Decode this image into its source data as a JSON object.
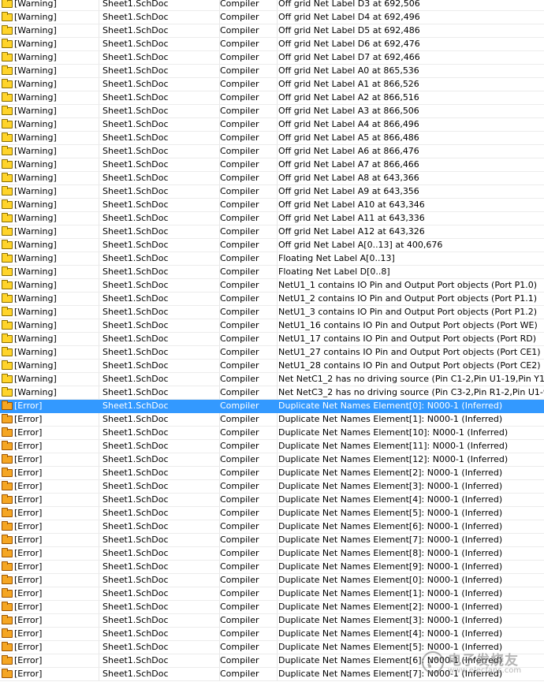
{
  "rows": [
    {
      "type": "warning",
      "label": "[Warning]",
      "document": "Sheet1.SchDoc",
      "source": "Compiler",
      "message": "Off grid Net Label D3 at 692,506"
    },
    {
      "type": "warning",
      "label": "[Warning]",
      "document": "Sheet1.SchDoc",
      "source": "Compiler",
      "message": "Off grid Net Label D4 at 692,496"
    },
    {
      "type": "warning",
      "label": "[Warning]",
      "document": "Sheet1.SchDoc",
      "source": "Compiler",
      "message": "Off grid Net Label D5 at 692,486"
    },
    {
      "type": "warning",
      "label": "[Warning]",
      "document": "Sheet1.SchDoc",
      "source": "Compiler",
      "message": "Off grid Net Label D6 at 692,476"
    },
    {
      "type": "warning",
      "label": "[Warning]",
      "document": "Sheet1.SchDoc",
      "source": "Compiler",
      "message": "Off grid Net Label D7 at 692,466"
    },
    {
      "type": "warning",
      "label": "[Warning]",
      "document": "Sheet1.SchDoc",
      "source": "Compiler",
      "message": "Off grid Net Label A0 at 865,536"
    },
    {
      "type": "warning",
      "label": "[Warning]",
      "document": "Sheet1.SchDoc",
      "source": "Compiler",
      "message": "Off grid Net Label A1 at 866,526"
    },
    {
      "type": "warning",
      "label": "[Warning]",
      "document": "Sheet1.SchDoc",
      "source": "Compiler",
      "message": "Off grid Net Label A2 at 866,516"
    },
    {
      "type": "warning",
      "label": "[Warning]",
      "document": "Sheet1.SchDoc",
      "source": "Compiler",
      "message": "Off grid Net Label A3 at 866,506"
    },
    {
      "type": "warning",
      "label": "[Warning]",
      "document": "Sheet1.SchDoc",
      "source": "Compiler",
      "message": "Off grid Net Label A4 at 866,496"
    },
    {
      "type": "warning",
      "label": "[Warning]",
      "document": "Sheet1.SchDoc",
      "source": "Compiler",
      "message": "Off grid Net Label A5 at 866,486"
    },
    {
      "type": "warning",
      "label": "[Warning]",
      "document": "Sheet1.SchDoc",
      "source": "Compiler",
      "message": "Off grid Net Label A6 at 866,476"
    },
    {
      "type": "warning",
      "label": "[Warning]",
      "document": "Sheet1.SchDoc",
      "source": "Compiler",
      "message": "Off grid Net Label A7 at 866,466"
    },
    {
      "type": "warning",
      "label": "[Warning]",
      "document": "Sheet1.SchDoc",
      "source": "Compiler",
      "message": "Off grid Net Label A8 at 643,366"
    },
    {
      "type": "warning",
      "label": "[Warning]",
      "document": "Sheet1.SchDoc",
      "source": "Compiler",
      "message": "Off grid Net Label A9 at 643,356"
    },
    {
      "type": "warning",
      "label": "[Warning]",
      "document": "Sheet1.SchDoc",
      "source": "Compiler",
      "message": "Off grid Net Label A10 at 643,346"
    },
    {
      "type": "warning",
      "label": "[Warning]",
      "document": "Sheet1.SchDoc",
      "source": "Compiler",
      "message": "Off grid Net Label A11 at 643,336"
    },
    {
      "type": "warning",
      "label": "[Warning]",
      "document": "Sheet1.SchDoc",
      "source": "Compiler",
      "message": "Off grid Net Label A12 at 643,326"
    },
    {
      "type": "warning",
      "label": "[Warning]",
      "document": "Sheet1.SchDoc",
      "source": "Compiler",
      "message": "Off grid Net Label A[0..13] at 400,676"
    },
    {
      "type": "warning",
      "label": "[Warning]",
      "document": "Sheet1.SchDoc",
      "source": "Compiler",
      "message": "Floating Net Label A[0..13]"
    },
    {
      "type": "warning",
      "label": "[Warning]",
      "document": "Sheet1.SchDoc",
      "source": "Compiler",
      "message": "Floating Net Label D[0..8]"
    },
    {
      "type": "warning",
      "label": "[Warning]",
      "document": "Sheet1.SchDoc",
      "source": "Compiler",
      "message": "NetU1_1 contains IO Pin and Output Port objects (Port P1.0)"
    },
    {
      "type": "warning",
      "label": "[Warning]",
      "document": "Sheet1.SchDoc",
      "source": "Compiler",
      "message": "NetU1_2 contains IO Pin and Output Port objects (Port P1.1)"
    },
    {
      "type": "warning",
      "label": "[Warning]",
      "document": "Sheet1.SchDoc",
      "source": "Compiler",
      "message": "NetU1_3 contains IO Pin and Output Port objects (Port P1.2)"
    },
    {
      "type": "warning",
      "label": "[Warning]",
      "document": "Sheet1.SchDoc",
      "source": "Compiler",
      "message": "NetU1_16 contains IO Pin and Output Port objects (Port WE)"
    },
    {
      "type": "warning",
      "label": "[Warning]",
      "document": "Sheet1.SchDoc",
      "source": "Compiler",
      "message": "NetU1_17 contains IO Pin and Output Port objects (Port RD)"
    },
    {
      "type": "warning",
      "label": "[Warning]",
      "document": "Sheet1.SchDoc",
      "source": "Compiler",
      "message": "NetU1_27 contains IO Pin and Output Port objects (Port CE1)"
    },
    {
      "type": "warning",
      "label": "[Warning]",
      "document": "Sheet1.SchDoc",
      "source": "Compiler",
      "message": "NetU1_28 contains IO Pin and Output Port objects (Port CE2)"
    },
    {
      "type": "warning",
      "label": "[Warning]",
      "document": "Sheet1.SchDoc",
      "source": "Compiler",
      "message": "Net NetC1_2 has no driving source (Pin C1-2,Pin U1-19,Pin Y1-2)"
    },
    {
      "type": "warning",
      "label": "[Warning]",
      "document": "Sheet1.SchDoc",
      "source": "Compiler",
      "message": "Net NetC3_2 has no driving source (Pin C3-2,Pin R1-2,Pin U1-9)"
    },
    {
      "type": "error",
      "label": "[Error]",
      "document": "Sheet1.SchDoc",
      "source": "Compiler",
      "message": "Duplicate Net Names Element[0]: N000-1 (Inferred)",
      "selected": true
    },
    {
      "type": "error",
      "label": "[Error]",
      "document": "Sheet1.SchDoc",
      "source": "Compiler",
      "message": "Duplicate Net Names Element[1]: N000-1 (Inferred)"
    },
    {
      "type": "error",
      "label": "[Error]",
      "document": "Sheet1.SchDoc",
      "source": "Compiler",
      "message": "Duplicate Net Names Element[10]: N000-1 (Inferred)"
    },
    {
      "type": "error",
      "label": "[Error]",
      "document": "Sheet1.SchDoc",
      "source": "Compiler",
      "message": "Duplicate Net Names Element[11]: N000-1 (Inferred)"
    },
    {
      "type": "error",
      "label": "[Error]",
      "document": "Sheet1.SchDoc",
      "source": "Compiler",
      "message": "Duplicate Net Names Element[12]: N000-1 (Inferred)"
    },
    {
      "type": "error",
      "label": "[Error]",
      "document": "Sheet1.SchDoc",
      "source": "Compiler",
      "message": "Duplicate Net Names Element[2]: N000-1 (Inferred)"
    },
    {
      "type": "error",
      "label": "[Error]",
      "document": "Sheet1.SchDoc",
      "source": "Compiler",
      "message": "Duplicate Net Names Element[3]: N000-1 (Inferred)"
    },
    {
      "type": "error",
      "label": "[Error]",
      "document": "Sheet1.SchDoc",
      "source": "Compiler",
      "message": "Duplicate Net Names Element[4]: N000-1 (Inferred)"
    },
    {
      "type": "error",
      "label": "[Error]",
      "document": "Sheet1.SchDoc",
      "source": "Compiler",
      "message": "Duplicate Net Names Element[5]: N000-1 (Inferred)"
    },
    {
      "type": "error",
      "label": "[Error]",
      "document": "Sheet1.SchDoc",
      "source": "Compiler",
      "message": "Duplicate Net Names Element[6]: N000-1 (Inferred)"
    },
    {
      "type": "error",
      "label": "[Error]",
      "document": "Sheet1.SchDoc",
      "source": "Compiler",
      "message": "Duplicate Net Names Element[7]: N000-1 (Inferred)"
    },
    {
      "type": "error",
      "label": "[Error]",
      "document": "Sheet1.SchDoc",
      "source": "Compiler",
      "message": "Duplicate Net Names Element[8]: N000-1 (Inferred)"
    },
    {
      "type": "error",
      "label": "[Error]",
      "document": "Sheet1.SchDoc",
      "source": "Compiler",
      "message": "Duplicate Net Names Element[9]: N000-1 (Inferred)"
    },
    {
      "type": "error",
      "label": "[Error]",
      "document": "Sheet1.SchDoc",
      "source": "Compiler",
      "message": "Duplicate Net Names Element[0]: N000-1 (Inferred)"
    },
    {
      "type": "error",
      "label": "[Error]",
      "document": "Sheet1.SchDoc",
      "source": "Compiler",
      "message": "Duplicate Net Names Element[1]: N000-1 (Inferred)"
    },
    {
      "type": "error",
      "label": "[Error]",
      "document": "Sheet1.SchDoc",
      "source": "Compiler",
      "message": "Duplicate Net Names Element[2]: N000-1 (Inferred)"
    },
    {
      "type": "error",
      "label": "[Error]",
      "document": "Sheet1.SchDoc",
      "source": "Compiler",
      "message": "Duplicate Net Names Element[3]: N000-1 (Inferred)"
    },
    {
      "type": "error",
      "label": "[Error]",
      "document": "Sheet1.SchDoc",
      "source": "Compiler",
      "message": "Duplicate Net Names Element[4]: N000-1 (Inferred)"
    },
    {
      "type": "error",
      "label": "[Error]",
      "document": "Sheet1.SchDoc",
      "source": "Compiler",
      "message": "Duplicate Net Names Element[5]: N000-1 (Inferred)"
    },
    {
      "type": "error",
      "label": "[Error]",
      "document": "Sheet1.SchDoc",
      "source": "Compiler",
      "message": "Duplicate Net Names Element[6]: N000-1 (Inferred)"
    },
    {
      "type": "error",
      "label": "[Error]",
      "document": "Sheet1.SchDoc",
      "source": "Compiler",
      "message": "Duplicate Net Names Element[7]: N000-1 (Inferred)"
    }
  ],
  "colors": {
    "selected_row": "#3399ff",
    "warning_icon": "#ffd42a",
    "error_icon": "#f5a623"
  },
  "icons": {
    "warning": "folder-warning-icon",
    "error": "folder-error-icon"
  },
  "watermark": {
    "brand": "电子发烧友",
    "url": "www.elecfans.com"
  }
}
